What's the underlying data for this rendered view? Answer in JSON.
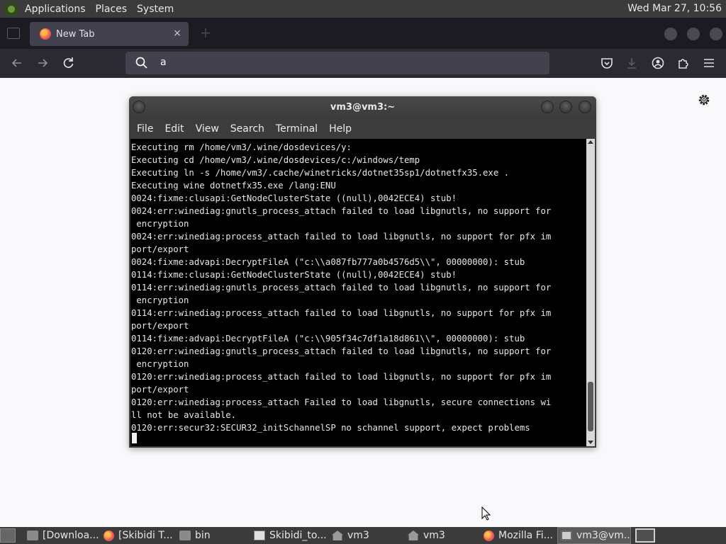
{
  "top_panel": {
    "menus": [
      "Applications",
      "Places",
      "System"
    ],
    "clock": "Wed Mar 27, 10:56"
  },
  "browser": {
    "tab_title": "New Tab",
    "tab_close": "×",
    "new_tab": "+",
    "url_text": "a"
  },
  "terminal": {
    "title": "vm3@vm3:~",
    "menus": [
      "File",
      "Edit",
      "View",
      "Search",
      "Terminal",
      "Help"
    ],
    "lines": [
      "Executing rm /home/vm3/.wine/dosdevices/y:",
      "Executing cd /home/vm3/.wine/dosdevices/c:/windows/temp",
      "Executing ln -s /home/vm3/.cache/winetricks/dotnet35sp1/dotnetfx35.exe .",
      "Executing wine dotnetfx35.exe /lang:ENU",
      "0024:fixme:clusapi:GetNodeClusterState ((null),0042ECE4) stub!",
      "0024:err:winediag:gnutls_process_attach failed to load libgnutls, no support for",
      " encryption",
      "0024:err:winediag:process_attach failed to load libgnutls, no support for pfx im",
      "port/export",
      "0024:fixme:advapi:DecryptFileA (\"c:\\\\a087fb777a0b4576d5\\\\\", 00000000): stub",
      "0114:fixme:clusapi:GetNodeClusterState ((null),0042ECE4) stub!",
      "0114:err:winediag:gnutls_process_attach failed to load libgnutls, no support for",
      " encryption",
      "0114:err:winediag:process_attach failed to load libgnutls, no support for pfx im",
      "port/export",
      "0114:fixme:advapi:DecryptFileA (\"c:\\\\905f34c7df1a18d861\\\\\", 00000000): stub",
      "0120:err:winediag:gnutls_process_attach failed to load libgnutls, no support for",
      " encryption",
      "0120:err:winediag:process_attach failed to load libgnutls, no support for pfx im",
      "port/export",
      "0120:err:winediag:process_attach Failed to load libgnutls, secure connections wi",
      "ll not be available.",
      "0120:err:secur32:SECUR32_initSchannelSP no schannel support, expect problems"
    ]
  },
  "taskbar": {
    "tasks": [
      {
        "label": "[Downloa...",
        "icon": "folder-icon"
      },
      {
        "label": "[Skibidi T...",
        "icon": "firefox-icon"
      },
      {
        "label": "bin",
        "icon": "folder-icon"
      },
      {
        "label": "Skibidi_to...",
        "icon": "text-editor-icon"
      },
      {
        "label": "vm3",
        "icon": "home-folder-icon"
      },
      {
        "label": "vm3",
        "icon": "home-folder-icon"
      },
      {
        "label": "Mozilla Fi...",
        "icon": "firefox-icon"
      },
      {
        "label": "vm3@vm...",
        "icon": "terminal-icon"
      }
    ]
  }
}
